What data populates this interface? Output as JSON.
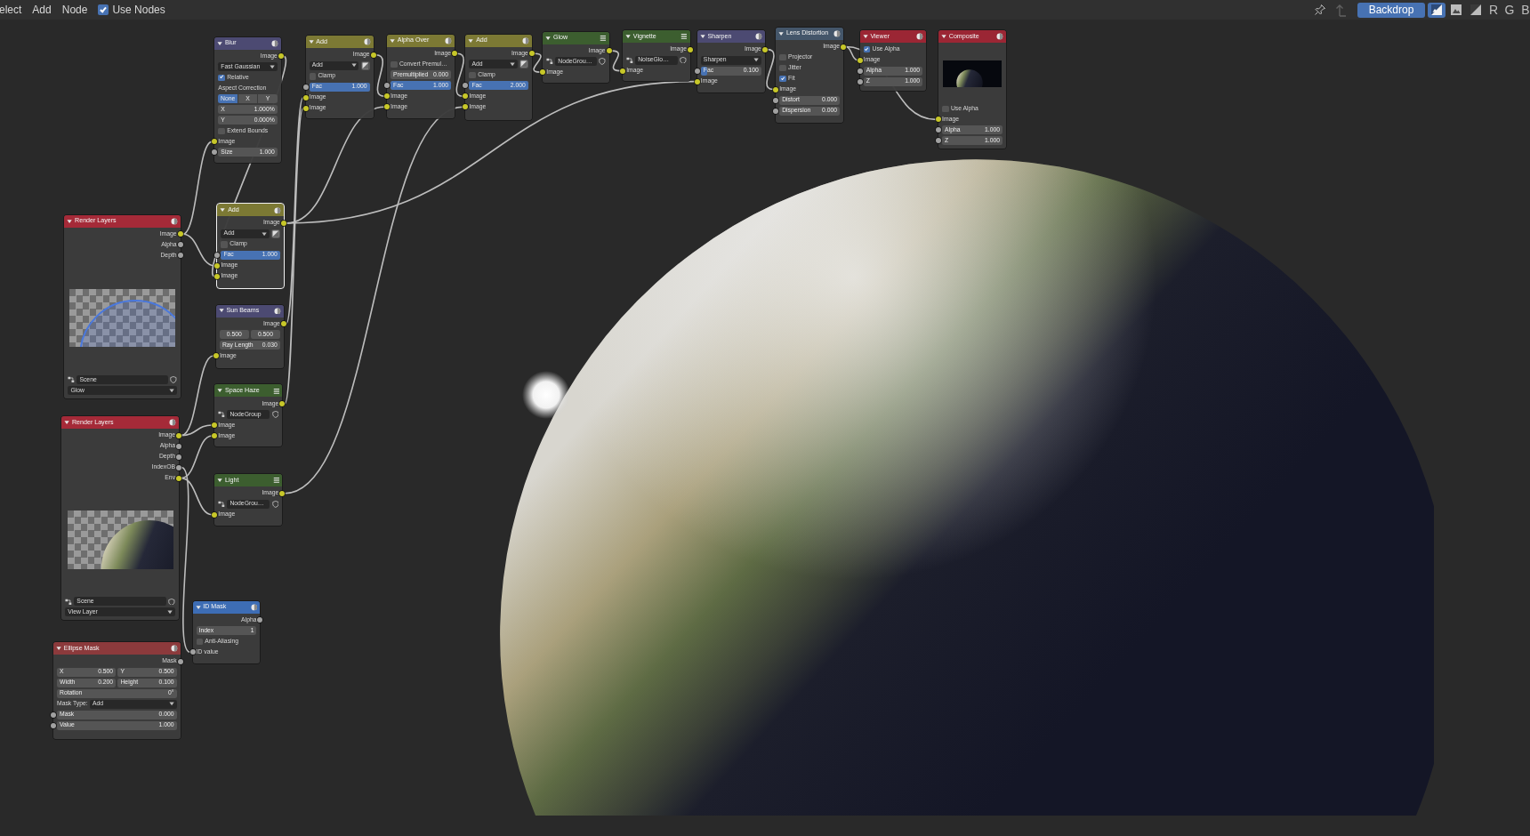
{
  "header": {
    "menus": [
      {
        "label": "elect"
      },
      {
        "label": "Add"
      },
      {
        "label": "Node"
      }
    ],
    "use_nodes": {
      "label": "Use Nodes",
      "checked": true
    },
    "parent": {
      "disabled": true
    },
    "backdrop": {
      "label": "Backdrop",
      "on": true
    },
    "display_modes": [
      {
        "selected": true
      },
      {
        "selected": false
      },
      {
        "selected": false
      }
    ],
    "channels": [
      {
        "label": "R",
        "selected": false
      },
      {
        "label": "G",
        "selected": false
      },
      {
        "label": "B",
        "selected": false
      }
    ]
  },
  "nodes": [
    {
      "title": "Blur",
      "kind": "node",
      "color": "#4c4a72",
      "selected": false,
      "rows": [
        {
          "kind": "output",
          "label": "Image",
          "socket": {
            "color": "#c7c729"
          }
        },
        {
          "kind": "dropdown",
          "value": "Fast Gaussian"
        },
        {
          "kind": "checkbox",
          "label": "Relative",
          "checked": true
        },
        {
          "kind": "label",
          "label": "Aspect Correction"
        },
        {
          "kind": "toggles",
          "options": [
            {
              "label": "None",
              "selected": true
            },
            {
              "label": "X",
              "selected": false
            },
            {
              "label": "Y",
              "selected": false
            }
          ]
        },
        {
          "kind": "field",
          "label": "X",
          "value": "1.000%"
        },
        {
          "kind": "field",
          "label": "Y",
          "value": "0.000%"
        },
        {
          "kind": "checkbox",
          "label": "Extend Bounds",
          "checked": false
        },
        {
          "kind": "input",
          "label": "Image",
          "socket": {
            "color": "#c7c729"
          }
        },
        {
          "kind": "field",
          "label": "Size",
          "value": "1.000",
          "socket": {
            "color": "#a1a1a1"
          }
        }
      ]
    },
    {
      "title": "Add",
      "kind": "node",
      "color": "#7c7934",
      "selected": false,
      "rows": [
        {
          "kind": "output",
          "label": "Image",
          "socket": {
            "color": "#c7c729"
          }
        },
        {
          "kind": "dropdown",
          "value": "Add",
          "icon_toggle": {
            "on": false
          }
        },
        {
          "kind": "checkbox",
          "label": "Clamp",
          "checked": false
        },
        {
          "kind": "field",
          "label": "Fac",
          "value": "1.000",
          "socket": {
            "color": "#a1a1a1"
          },
          "level": 1
        },
        {
          "kind": "input",
          "label": "Image",
          "socket": {
            "color": "#c7c729"
          }
        },
        {
          "kind": "input",
          "label": "Image",
          "socket": {
            "color": "#c7c729"
          }
        }
      ]
    },
    {
      "title": "Alpha Over",
      "kind": "node",
      "color": "#7c7934",
      "selected": false,
      "rows": [
        {
          "kind": "output",
          "label": "Image",
          "socket": {
            "color": "#c7c729"
          }
        },
        {
          "kind": "checkbox",
          "label": "Convert Premul…",
          "checked": false
        },
        {
          "kind": "field",
          "label": "Premultiplied",
          "value": "0.000"
        },
        {
          "kind": "field",
          "label": "Fac",
          "value": "1.000",
          "socket": {
            "color": "#a1a1a1"
          },
          "level": 1
        },
        {
          "kind": "input",
          "label": "Image",
          "socket": {
            "color": "#c7c729"
          }
        },
        {
          "kind": "input",
          "label": "Image",
          "socket": {
            "color": "#c7c729"
          }
        }
      ]
    },
    {
      "title": "Add",
      "kind": "node",
      "color": "#7c7934",
      "selected": false,
      "rows": [
        {
          "kind": "output",
          "label": "Image",
          "socket": {
            "color": "#c7c729"
          }
        },
        {
          "kind": "dropdown",
          "value": "Add",
          "icon_toggle": {
            "on": false
          }
        },
        {
          "kind": "checkbox",
          "label": "Clamp",
          "checked": false
        },
        {
          "kind": "field",
          "label": "Fac",
          "value": "2.000",
          "socket": {
            "color": "#a1a1a1"
          },
          "level": 1
        },
        {
          "kind": "input",
          "label": "Image",
          "socket": {
            "color": "#c7c729"
          }
        },
        {
          "kind": "input",
          "label": "Image",
          "socket": {
            "color": "#c7c729"
          }
        }
      ]
    },
    {
      "title": "Glow",
      "kind": "group",
      "color": "#3c5e2f",
      "selected": false,
      "rows": [
        {
          "kind": "output",
          "label": "Image",
          "socket": {
            "color": "#c7c729"
          }
        },
        {
          "kind": "datablock",
          "value": "NodeGrou…"
        },
        {
          "kind": "input",
          "label": "Image",
          "socket": {
            "color": "#c7c729"
          }
        }
      ]
    },
    {
      "title": "Vignette",
      "kind": "group",
      "color": "#3c5e2f",
      "selected": false,
      "rows": [
        {
          "kind": "output",
          "label": "Image",
          "socket": {
            "color": "#c7c729"
          }
        },
        {
          "kind": "datablock",
          "value": "NoiseGlo…"
        },
        {
          "kind": "input",
          "label": "Image",
          "socket": {
            "color": "#c7c729"
          }
        }
      ]
    },
    {
      "title": "Sharpen",
      "kind": "node",
      "color": "#4c4a72",
      "selected": false,
      "rows": [
        {
          "kind": "output",
          "label": "Image",
          "socket": {
            "color": "#c7c729"
          }
        },
        {
          "kind": "dropdown",
          "value": "Sharpen"
        },
        {
          "kind": "field",
          "label": "Fac",
          "value": "0.100",
          "socket": {
            "color": "#a1a1a1"
          },
          "level": 0.1
        },
        {
          "kind": "input",
          "label": "Image",
          "socket": {
            "color": "#c7c729"
          }
        }
      ]
    },
    {
      "title": "Lens Distortion",
      "kind": "node",
      "color": "#44566a",
      "selected": false,
      "rows": [
        {
          "kind": "output",
          "label": "Image",
          "socket": {
            "color": "#c7c729"
          }
        },
        {
          "kind": "checkbox",
          "label": "Projector",
          "checked": false
        },
        {
          "kind": "checkbox",
          "label": "Jitter",
          "checked": false
        },
        {
          "kind": "checkbox",
          "label": "Fit",
          "checked": true
        },
        {
          "kind": "input",
          "label": "Image",
          "socket": {
            "color": "#c7c729"
          }
        },
        {
          "kind": "field",
          "label": "Distort",
          "value": "0.000",
          "socket": {
            "color": "#a1a1a1"
          }
        },
        {
          "kind": "field",
          "label": "Dispersion",
          "value": "0.000",
          "socket": {
            "color": "#a1a1a1"
          }
        }
      ]
    },
    {
      "title": "Viewer",
      "kind": "node",
      "color": "#9b2634",
      "selected": false,
      "rows": [
        {
          "kind": "checkbox",
          "label": "Use Alpha",
          "checked": true
        },
        {
          "kind": "input",
          "label": "Image",
          "socket": {
            "color": "#c7c729"
          }
        },
        {
          "kind": "field",
          "label": "Alpha",
          "value": "1.000",
          "socket": {
            "color": "#a1a1a1"
          }
        },
        {
          "kind": "field",
          "label": "Z",
          "value": "1.000",
          "socket": {
            "color": "#a1a1a1"
          }
        }
      ]
    },
    {
      "title": "Composite",
      "kind": "node",
      "color": "#9b2634",
      "selected": false,
      "rows": [
        {
          "kind": "planet_preview",
          "transparent": false
        },
        {
          "kind": "checkbox",
          "label": "Use Alpha",
          "checked": false
        },
        {
          "kind": "input",
          "label": "Image",
          "socket": {
            "color": "#c7c729"
          }
        },
        {
          "kind": "field",
          "label": "Alpha",
          "value": "1.000",
          "socket": {
            "color": "#a1a1a1"
          }
        },
        {
          "kind": "field",
          "label": "Z",
          "value": "1.000",
          "socket": {
            "color": "#a1a1a1"
          }
        }
      ]
    },
    {
      "title": "Render Layers",
      "kind": "node",
      "color": "#a52a38",
      "selected": false,
      "rows": [
        {
          "kind": "output",
          "label": "Image",
          "socket": {
            "color": "#c7c729"
          }
        },
        {
          "kind": "output",
          "label": "Alpha",
          "socket": {
            "color": "#a1a1a1"
          }
        },
        {
          "kind": "output",
          "label": "Depth",
          "socket": {
            "color": "#a1a1a1"
          }
        },
        {
          "kind": "ring_preview",
          "transparent": true
        },
        {
          "kind": "datablock",
          "value": "Scene"
        },
        {
          "kind": "dropdown",
          "value": "Glow"
        }
      ]
    },
    {
      "title": "Add",
      "kind": "node",
      "color": "#7c7934",
      "selected": true,
      "rows": [
        {
          "kind": "output",
          "label": "Image",
          "socket": {
            "color": "#c7c729"
          }
        },
        {
          "kind": "dropdown",
          "value": "Add",
          "icon_toggle": {
            "on": false
          }
        },
        {
          "kind": "checkbox",
          "label": "Clamp",
          "checked": false
        },
        {
          "kind": "field",
          "label": "Fac",
          "value": "1.000",
          "socket": {
            "color": "#a1a1a1"
          },
          "level": 1
        },
        {
          "kind": "input",
          "label": "Image",
          "socket": {
            "color": "#c7c729"
          }
        },
        {
          "kind": "input",
          "label": "Image",
          "socket": {
            "color": "#c7c729"
          }
        }
      ]
    },
    {
      "title": "Sun Beams",
      "kind": "node",
      "color": "#4c4a72",
      "selected": false,
      "rows": [
        {
          "kind": "output",
          "label": "Image",
          "socket": {
            "color": "#c7c729"
          }
        },
        {
          "kind": "pair",
          "fields": [
            {
              "value": "0.500"
            },
            {
              "value": "0.500"
            }
          ]
        },
        {
          "kind": "field",
          "label": "Ray Length",
          "value": "0.030"
        },
        {
          "kind": "input",
          "label": "Image",
          "socket": {
            "color": "#c7c729"
          }
        }
      ]
    },
    {
      "title": "Space Haze",
      "kind": "group",
      "color": "#3c5e2f",
      "selected": false,
      "rows": [
        {
          "kind": "output",
          "label": "Image",
          "socket": {
            "color": "#c7c729"
          }
        },
        {
          "kind": "datablock",
          "value": "NodeGroup"
        },
        {
          "kind": "input",
          "label": "Image",
          "socket": {
            "color": "#c7c729"
          }
        },
        {
          "kind": "input",
          "label": "Image",
          "socket": {
            "color": "#c7c729"
          }
        }
      ]
    },
    {
      "title": "Render Layers",
      "kind": "node",
      "color": "#a52a38",
      "selected": false,
      "rows": [
        {
          "kind": "output",
          "label": "Image",
          "socket": {
            "color": "#c7c729"
          }
        },
        {
          "kind": "output",
          "label": "Alpha",
          "socket": {
            "color": "#a1a1a1"
          }
        },
        {
          "kind": "output",
          "label": "Depth",
          "socket": {
            "color": "#a1a1a1"
          }
        },
        {
          "kind": "output",
          "label": "IndexOB",
          "socket": {
            "color": "#a1a1a1"
          }
        },
        {
          "kind": "output",
          "label": "Env",
          "socket": {
            "color": "#c7c729"
          }
        },
        {
          "kind": "planet_preview",
          "transparent": true
        },
        {
          "kind": "datablock",
          "value": "Scene"
        },
        {
          "kind": "dropdown",
          "value": "View Layer"
        }
      ]
    },
    {
      "title": "Light",
      "kind": "group",
      "color": "#3c5e2f",
      "selected": false,
      "rows": [
        {
          "kind": "output",
          "label": "Image",
          "socket": {
            "color": "#c7c729"
          }
        },
        {
          "kind": "datablock",
          "value": "NodeGrou…"
        },
        {
          "kind": "input",
          "label": "Image",
          "socket": {
            "color": "#c7c729"
          }
        }
      ]
    },
    {
      "title": "ID Mask",
      "kind": "node",
      "color": "#3d6db5",
      "selected": false,
      "rows": [
        {
          "kind": "output",
          "label": "Alpha",
          "socket": {
            "color": "#a1a1a1"
          }
        },
        {
          "kind": "field",
          "label": "Index",
          "value": "1"
        },
        {
          "kind": "checkbox",
          "label": "Anti-Aliasing",
          "checked": false
        },
        {
          "kind": "input",
          "label": "ID value",
          "socket": {
            "color": "#a1a1a1"
          }
        }
      ]
    },
    {
      "title": "Ellipse Mask",
      "kind": "node",
      "color": "#8c3a3c",
      "selected": false,
      "rows": [
        {
          "kind": "output",
          "label": "Mask",
          "socket": {
            "color": "#a1a1a1"
          }
        },
        {
          "kind": "pair",
          "fields": [
            {
              "label": "X",
              "value": "0.500"
            },
            {
              "label": "Y",
              "value": "0.500"
            }
          ]
        },
        {
          "kind": "pair",
          "fields": [
            {
              "label": "Width",
              "value": "0.200"
            },
            {
              "label": "Height",
              "value": "0.100"
            }
          ]
        },
        {
          "kind": "field",
          "label": "Rotation",
          "value": "0°"
        },
        {
          "kind": "dropdown",
          "label": "Mask Type:",
          "value": "Add"
        },
        {
          "kind": "field",
          "label": "Mask",
          "value": "0.000",
          "socket": {
            "color": "#a1a1a1"
          }
        },
        {
          "kind": "field",
          "label": "Value",
          "value": "1.000",
          "socket": {
            "color": "#a1a1a1"
          }
        }
      ]
    }
  ]
}
